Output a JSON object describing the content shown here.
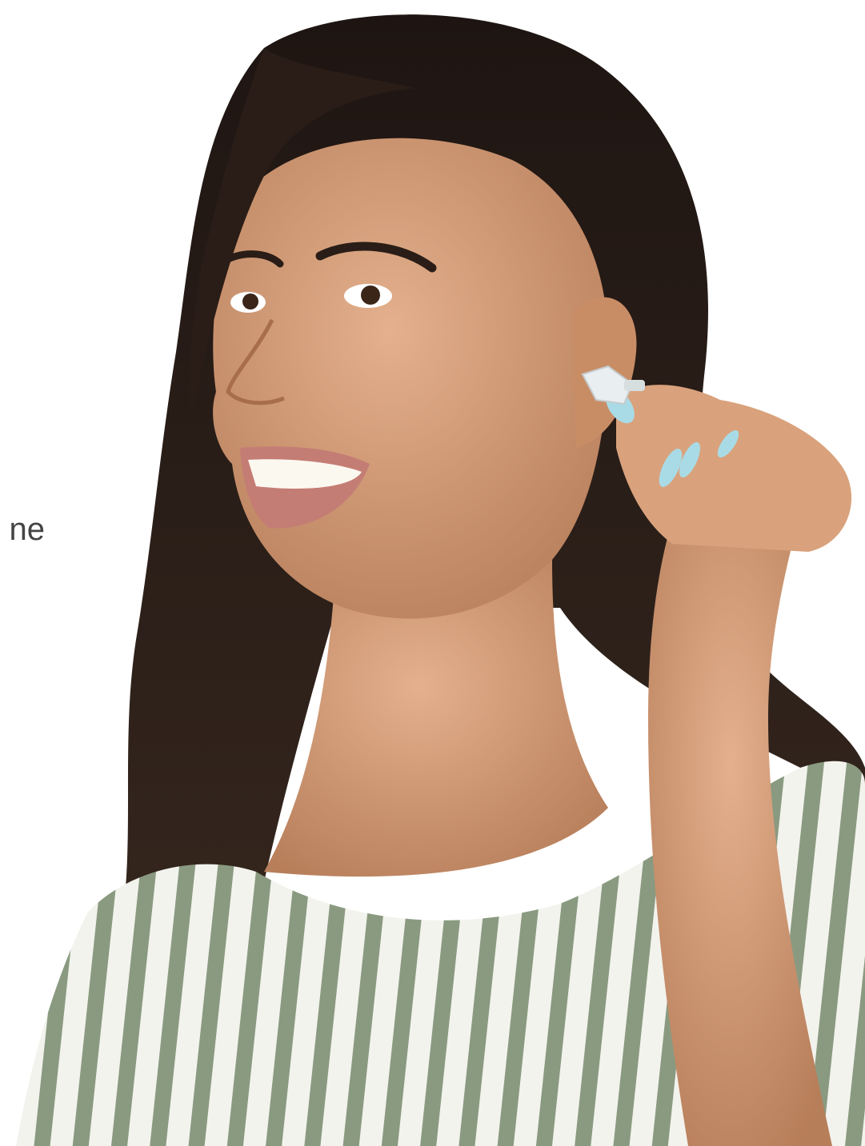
{
  "overlay_text": "ne",
  "colors": {
    "background": "#ffffff",
    "hair": "#2a1d17",
    "skin": "#d9a27c",
    "skin_shadow": "#b77e5a",
    "lips": "#c47d74",
    "teeth": "#fbf8f0",
    "nails": "#a9dbe6",
    "earplug": "#e9eef0",
    "stripe_green": "#8a9a80",
    "stripe_white": "#f3f3ee"
  },
  "subject": {
    "icon": "woman-inserting-earplug-photo"
  }
}
